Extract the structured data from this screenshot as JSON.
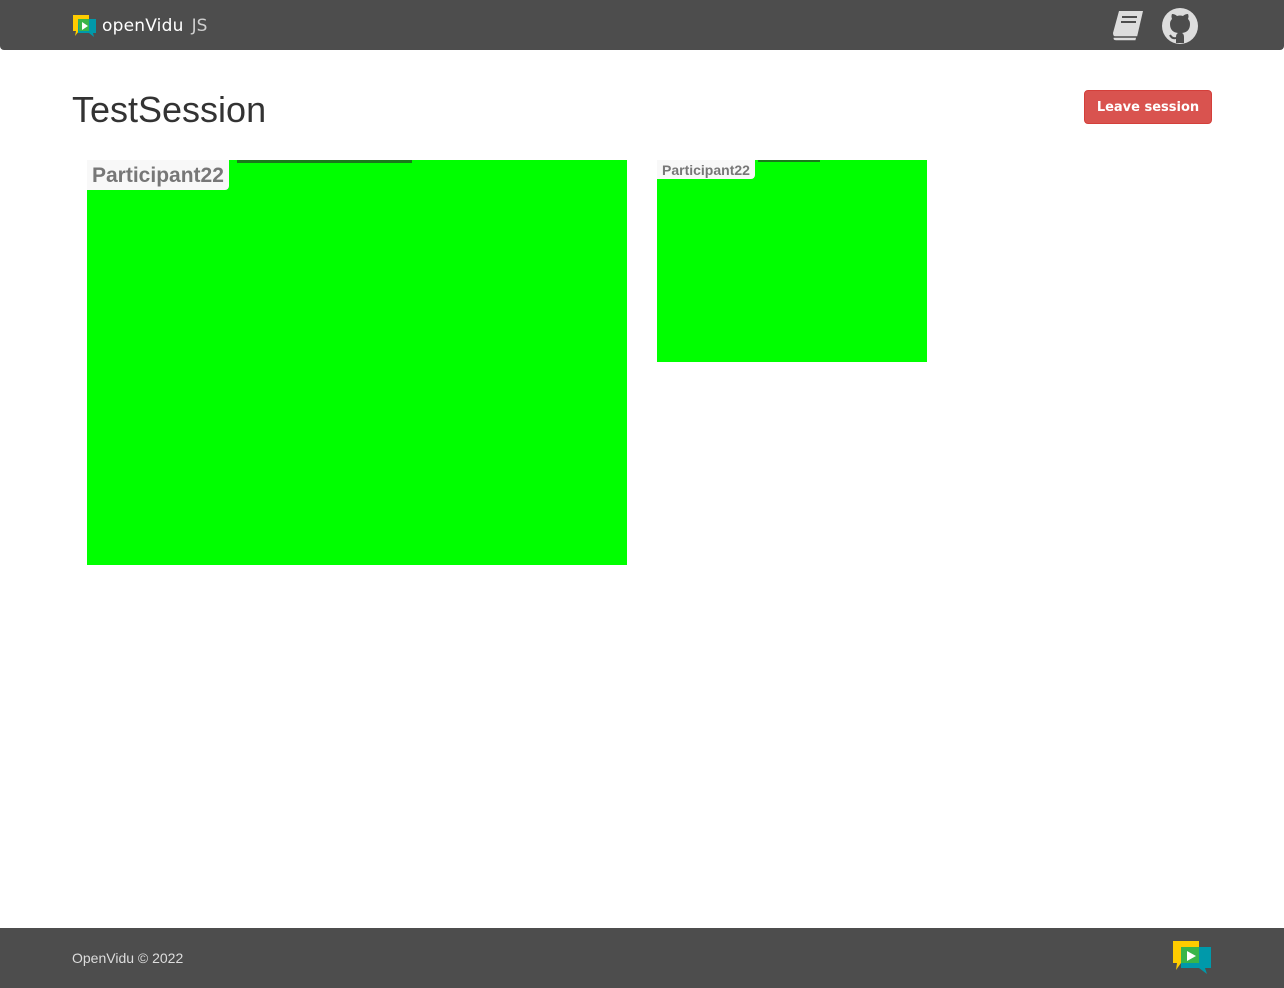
{
  "header": {
    "brand_name": "openVidu",
    "brand_suffix": "JS",
    "icons": [
      "logo-icon",
      "docs-book-icon",
      "github-icon"
    ]
  },
  "session": {
    "title": "TestSession",
    "leave_button": "Leave session"
  },
  "videos": {
    "main": {
      "participant": "Participant22",
      "background": "#00ff00"
    },
    "thumb": {
      "participant": "Participant22",
      "background": "#00ff00"
    }
  },
  "footer": {
    "copyright": "OpenVidu © 2022"
  },
  "colors": {
    "nav_background": "#4d4d4d",
    "leave_button": "#d9534f",
    "video_stream": "#00ff00",
    "logo_yellow": "#ffcc00",
    "logo_teal": "#0099aa"
  }
}
